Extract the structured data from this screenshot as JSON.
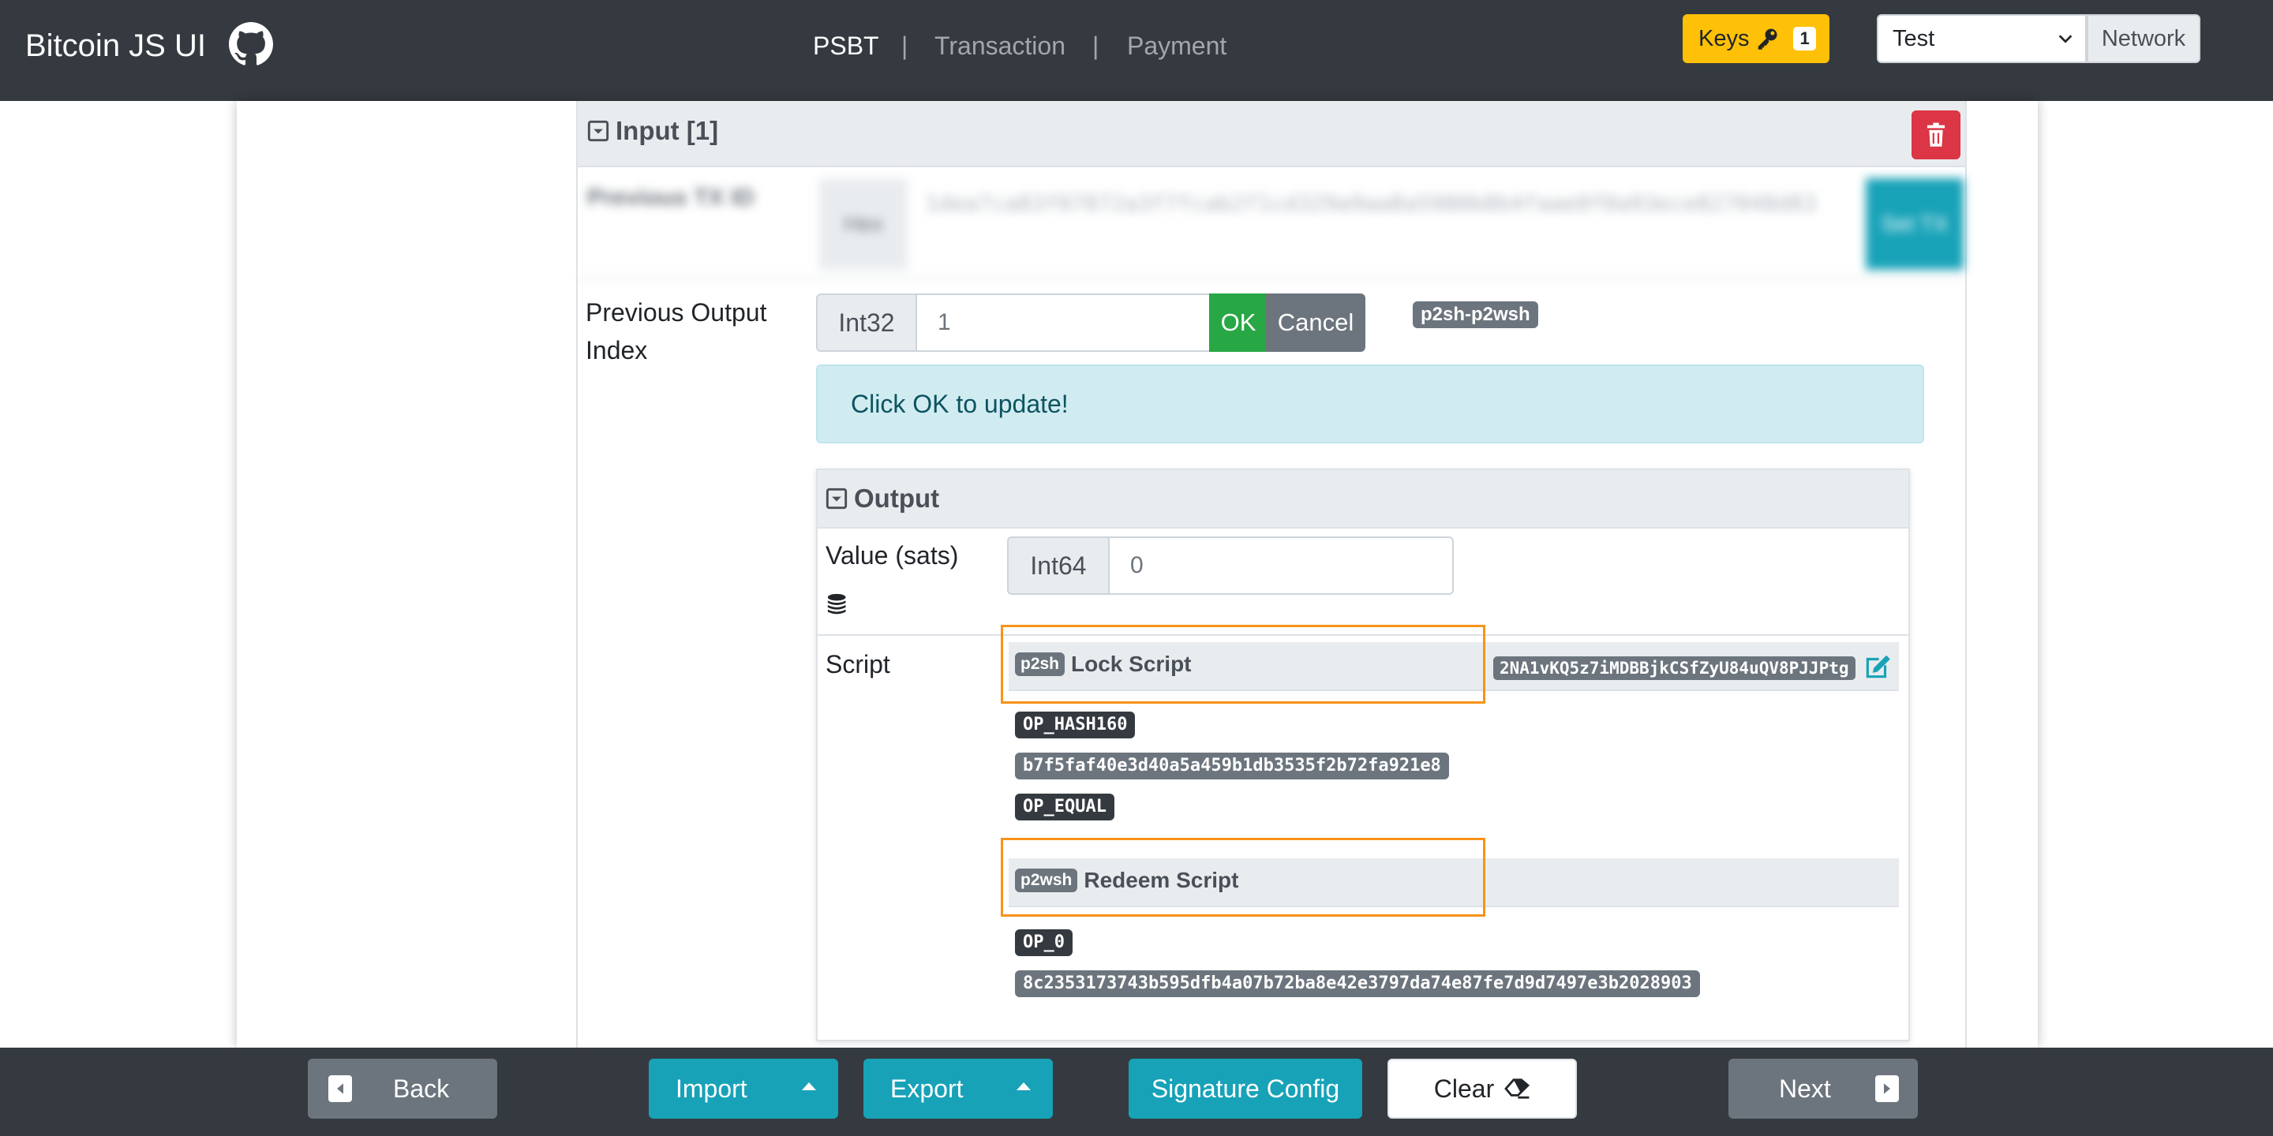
{
  "app": {
    "title": "Bitcoin JS UI"
  },
  "nav": {
    "items": [
      "PSBT",
      "Transaction",
      "Payment"
    ],
    "separator": "|"
  },
  "header": {
    "keys_label": "Keys",
    "keys_count": "1",
    "network_value": "Test",
    "network_label": "Network"
  },
  "input": {
    "title": "Input [1]",
    "prev_tx": {
      "label": "Previous TX ID",
      "prefix": "Hex",
      "value": "1dea7ca83f07872a3f7fcab2f1cd329a9aa8a5980b8b4faae0f0a93ece827048d83",
      "button": "Set TX"
    },
    "prev_output": {
      "label": "Previous Output Index",
      "prefix": "Int32",
      "value": "1",
      "ok": "OK",
      "cancel": "Cancel",
      "type_badge": "p2sh-p2wsh"
    },
    "alert": "Click OK to update!"
  },
  "output": {
    "title": "Output",
    "value_label": "Value (sats)",
    "value_prefix": "Int64",
    "value": "0",
    "script_label": "Script",
    "lock": {
      "badge": "p2sh",
      "title": "Lock Script",
      "address": "2NA1vKQ5z7iMDBBjkCSfZyU84uQV8PJJPtg",
      "ops": [
        "OP_HASH160",
        "b7f5faf40e3d40a5a459b1db3535f2b72fa921e8",
        "OP_EQUAL"
      ]
    },
    "redeem": {
      "badge": "p2wsh",
      "title": "Redeem Script",
      "ops": [
        "OP_0",
        "8c2353173743b595dfb4a07b72ba8e42e3797da74e87fe7d9d7497e3b2028903"
      ]
    }
  },
  "footer": {
    "back": "Back",
    "import": "Import",
    "export": "Export",
    "signature": "Signature Config",
    "clear": "Clear",
    "next": "Next"
  },
  "colors": {
    "accent": "#17a2b8",
    "highlight": "#f7931a",
    "danger": "#dc3545",
    "success": "#28a745",
    "warning": "#ffc107"
  }
}
